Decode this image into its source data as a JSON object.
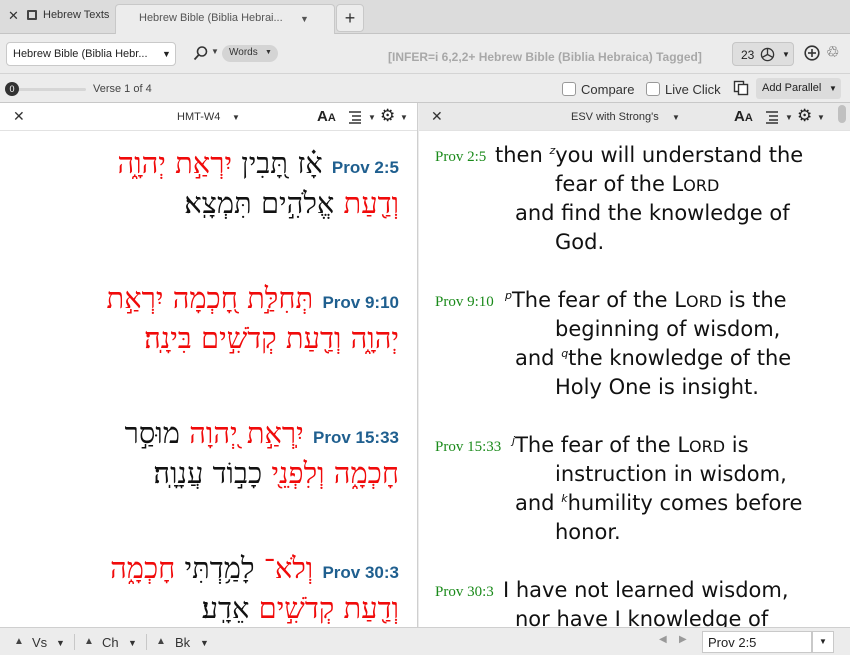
{
  "tabbar": {
    "tab1_label": "Hebrew Texts",
    "tab2_label": "Hebrew Bible (Biblia Hebrai...",
    "new_tab": "+"
  },
  "resource_toolbar": {
    "resource_label": "Hebrew Bible (Biblia Hebr...",
    "search_mode": "Words",
    "info": "[INFER=i 6,2,2+ Hebrew Bible (Biblia Hebraica) Tagged]",
    "sync_number": "23"
  },
  "verse_toolbar": {
    "slider_value": "0",
    "verse_of": "Verse 1 of 4",
    "compare_label": "Compare",
    "live_click_label": "Live Click",
    "add_parallel_label": "Add Parallel"
  },
  "left_pane": {
    "title": "HMT-W4",
    "font_size_icon": "AA",
    "verses": [
      {
        "ref": "Prov 2:5",
        "line1": [
          {
            "text": "אָ֗ז",
            "color": "#111111"
          },
          {
            "text": "תָּ֭בִין",
            "color": "#111111"
          },
          {
            "text": "יִרְאַ֣ת",
            "color": "#f00a0a"
          },
          {
            "text": "יְהוָ֑ה",
            "color": "#f00a0a"
          }
        ],
        "line2": [
          {
            "text": "וְדַ֖עַת",
            "color": "#f00a0a"
          },
          {
            "text": "אֱלֹהִ֣ים",
            "color": "#111111"
          },
          {
            "text": "תִּמְצָֽא׃",
            "color": "#111111"
          }
        ]
      },
      {
        "ref": "Prov 9:10",
        "line1": [
          {
            "text": "תְּחִלַּ֣ת",
            "color": "#f00a0a"
          },
          {
            "text": "חָ֭כְמָה",
            "color": "#f00a0a"
          },
          {
            "text": "יִרְאַ֣ת",
            "color": "#f00a0a"
          }
        ],
        "line2": [
          {
            "text": "יְהוָ֑ה",
            "color": "#f00a0a"
          },
          {
            "text": "וְדַ֖עַת",
            "color": "#f00a0a"
          },
          {
            "text": "קְדֹשִׁ֣ים",
            "color": "#f00a0a"
          },
          {
            "text": "בִּינָֽה׃",
            "color": "#f00a0a"
          }
        ]
      },
      {
        "ref": "Prov 15:33",
        "line1": [
          {
            "text": "יִֽרְאַ֣ת",
            "color": "#f00a0a"
          },
          {
            "text": "יְ֭הוָה",
            "color": "#f00a0a"
          },
          {
            "text": "מוּסַ֣ר",
            "color": "#111111"
          }
        ],
        "line2": [
          {
            "text": "חָכְמָ֑ה",
            "color": "#f00a0a"
          },
          {
            "text": "וְלִפְנֵ֖י",
            "color": "#f00a0a"
          },
          {
            "text": "כָב֣וֹד",
            "color": "#111111"
          },
          {
            "text": "עֲנָוָֽה׃",
            "color": "#111111"
          }
        ]
      },
      {
        "ref": "Prov 30:3",
        "line1": [
          {
            "text": "וְלֹא־",
            "color": "#f00a0a"
          },
          {
            "text": "לָמַ֥דְתִּי",
            "color": "#111111"
          },
          {
            "text": "חָכְמָ֑ה",
            "color": "#f00a0a"
          }
        ],
        "line2": [
          {
            "text": "וְדַ֖עַת",
            "color": "#f00a0a"
          },
          {
            "text": "קְדֹשִׁ֣ים",
            "color": "#f00a0a"
          },
          {
            "text": "אֵדָֽע׃",
            "color": "#111111"
          }
        ]
      }
    ]
  },
  "right_pane": {
    "title": "ESV with Strong's",
    "font_size_icon": "AA",
    "verses": [
      {
        "ref": "Prov 2:5",
        "lines": [
          {
            "sup": "",
            "pre": "then ",
            "marker": "z",
            "text": "you will understand the"
          },
          {
            "sup": "",
            "pre": "",
            "marker": "",
            "text": "fear of the ",
            "lord": true
          },
          {
            "sup": "",
            "pre": "",
            "marker": "",
            "text": "and find the knowledge of"
          },
          {
            "sup": "",
            "pre": "",
            "marker": "",
            "text": "God."
          }
        ]
      },
      {
        "ref": "Prov 9:10",
        "lines": [
          {
            "pre": "",
            "marker": "p",
            "text": "The fear of the ",
            "lord": true,
            "post": " is the"
          },
          {
            "pre": "",
            "marker": "",
            "text": "beginning of wisdom,"
          },
          {
            "pre": "and ",
            "marker": "q",
            "text": "the knowledge of the"
          },
          {
            "pre": "",
            "marker": "",
            "text": "Holy One is insight."
          }
        ]
      },
      {
        "ref": "Prov 15:33",
        "lines": [
          {
            "pre": "",
            "marker": "j",
            "text": "The fear of the ",
            "lord": true,
            "post": " is"
          },
          {
            "pre": "",
            "marker": "",
            "text": "instruction in wisdom,"
          },
          {
            "pre": "and ",
            "marker": "k",
            "text": "humility comes before"
          },
          {
            "pre": "",
            "marker": "",
            "text": "honor."
          }
        ]
      },
      {
        "ref": "Prov 30:3",
        "lines": [
          {
            "pre": "",
            "marker": "",
            "text": "I have not learned wisdom,"
          },
          {
            "pre": "",
            "marker": "",
            "text": "nor have I knowledge of"
          }
        ]
      }
    ],
    "lord_L": "L",
    "lord_rest": "ORD"
  },
  "bottom_bar": {
    "verse_label": "Vs",
    "chapter_label": "Ch",
    "book_label": "Bk",
    "reference": "Prov 2:5"
  }
}
